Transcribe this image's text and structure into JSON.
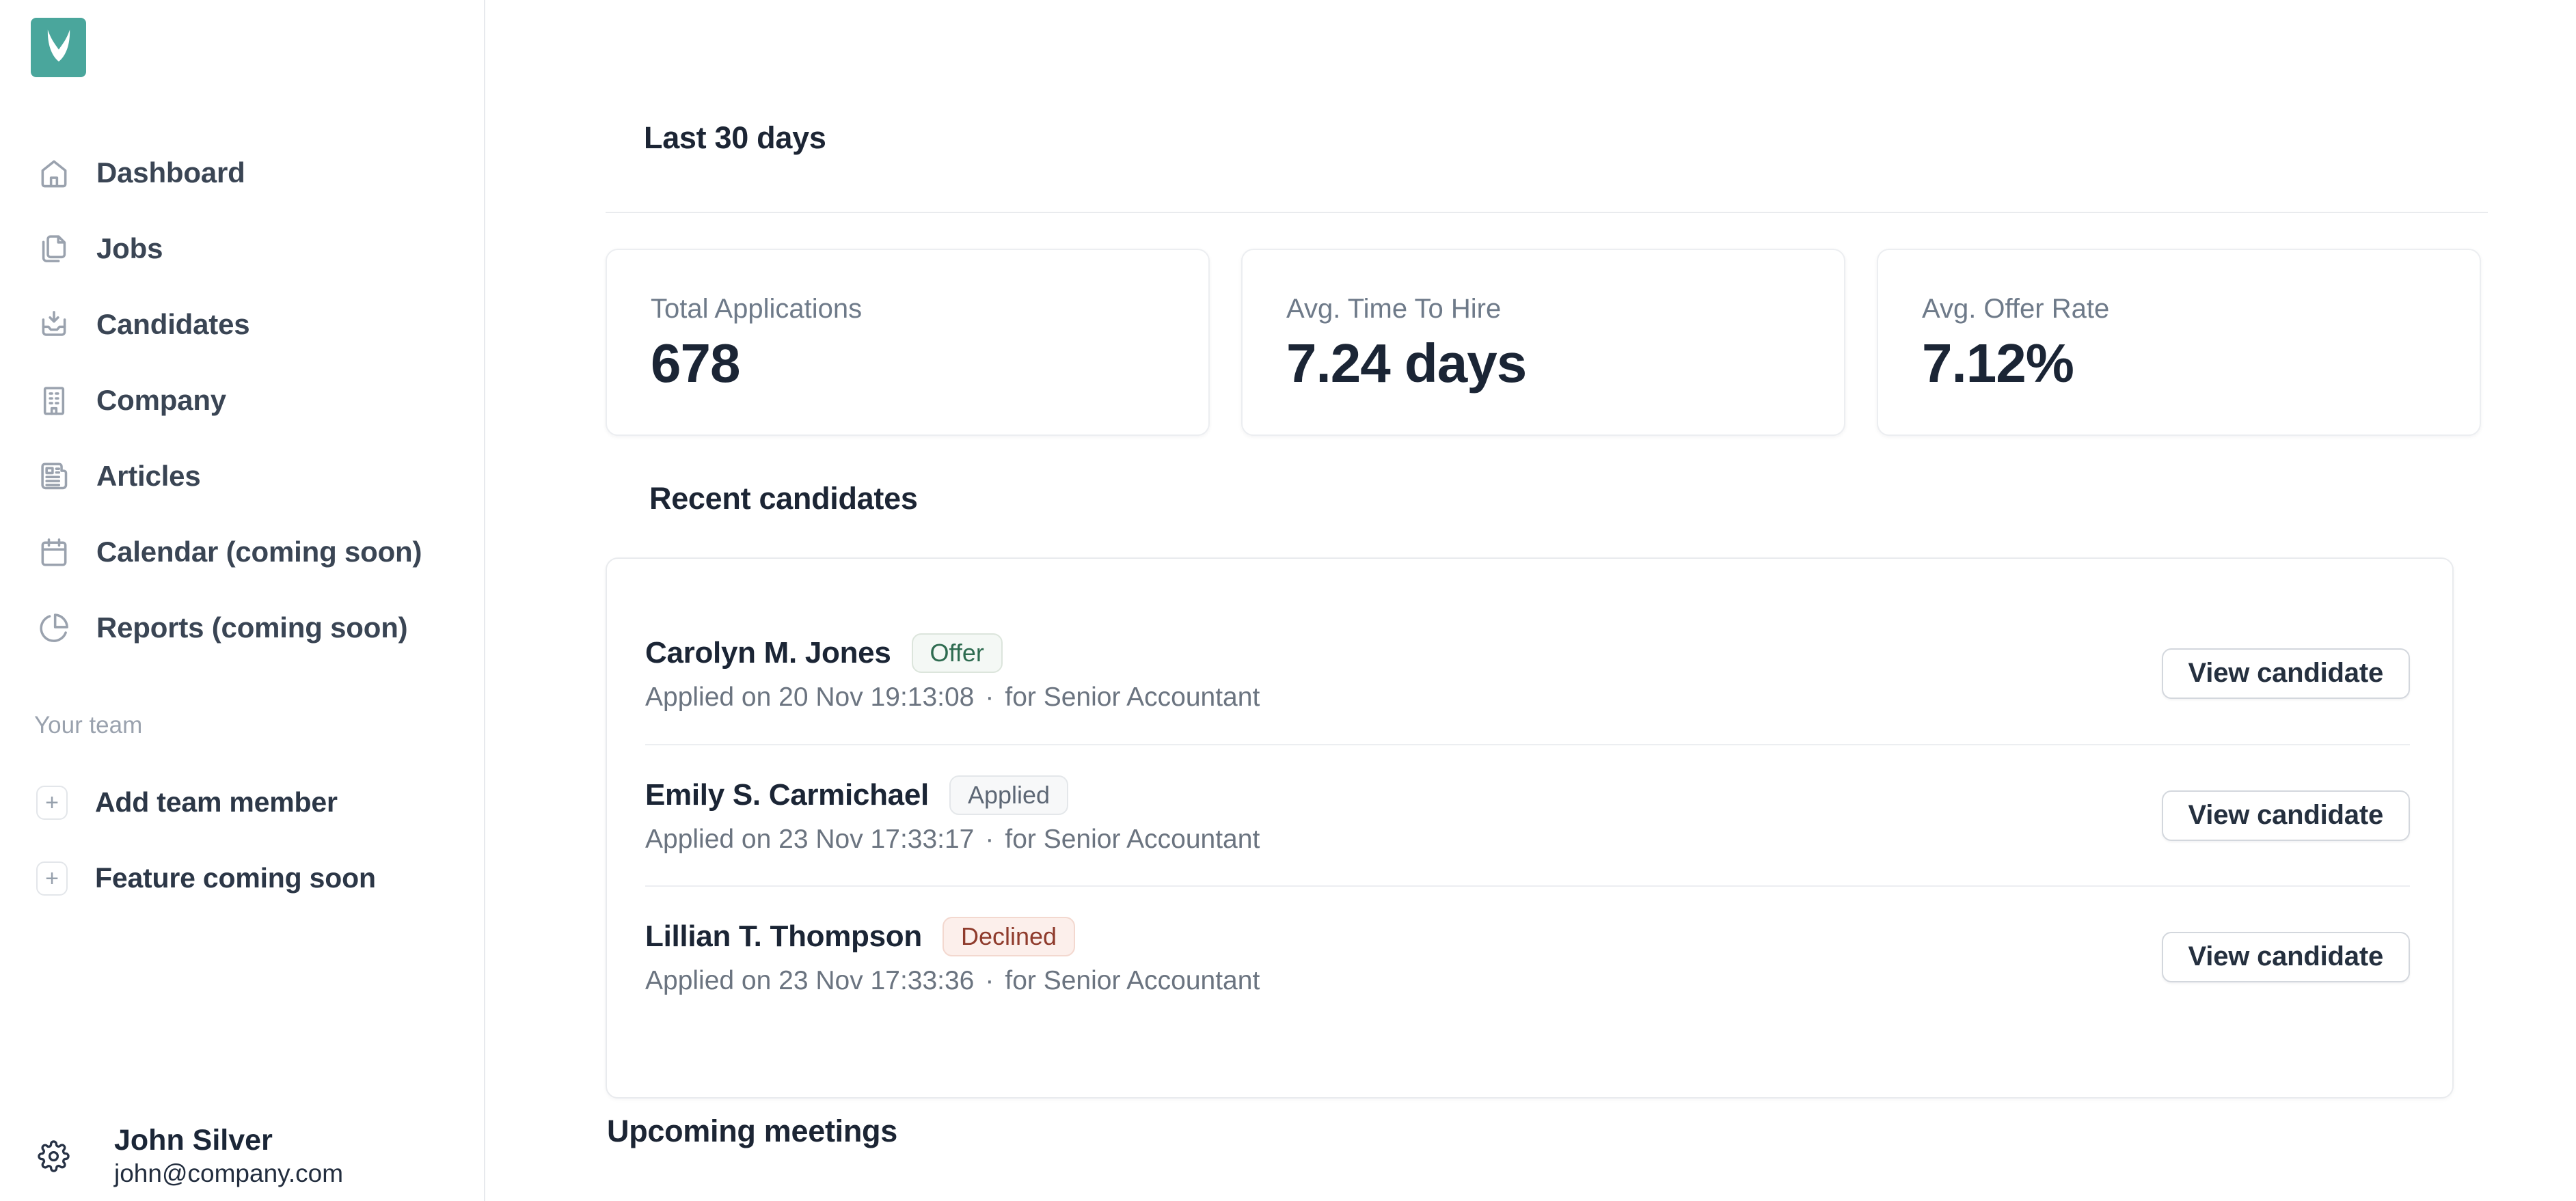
{
  "colors": {
    "brand_teal": "#4aa69c",
    "dark_text": "#1b2535",
    "muted_text": "#6b7480",
    "icon_gray": "#9aa2ae",
    "border_gray": "#e9ebee",
    "status_offer_text": "#2e6b50",
    "status_applied_text": "#5d6775",
    "status_declined_text": "#8f3b2c"
  },
  "sidebar": {
    "logo_icon": "butterfly-logo",
    "nav": [
      {
        "label": "Dashboard",
        "icon": "home-icon"
      },
      {
        "label": "Jobs",
        "icon": "document-icon"
      },
      {
        "label": "Candidates",
        "icon": "inbox-down-icon"
      },
      {
        "label": "Company",
        "icon": "building-icon"
      },
      {
        "label": "Articles",
        "icon": "newspaper-icon"
      },
      {
        "label": "Calendar (coming soon)",
        "icon": "calendar-icon"
      },
      {
        "label": "Reports (coming soon)",
        "icon": "pie-chart-icon"
      }
    ],
    "team_section_label": "Your team",
    "plus_glyph": "+",
    "team_items": [
      {
        "label": "Add team member",
        "icon": "plus-icon"
      },
      {
        "label": "Feature coming soon",
        "icon": "plus-icon"
      }
    ],
    "user": {
      "name": "John Silver",
      "email": "john@company.com",
      "settings_icon": "gear-icon"
    }
  },
  "main": {
    "period_heading": "Last 30 days",
    "stats": [
      {
        "label": "Total Applications",
        "value": "678"
      },
      {
        "label": "Avg. Time To Hire",
        "value": "7.24 days"
      },
      {
        "label": "Avg. Offer Rate",
        "value": "7.12%"
      }
    ],
    "recent": {
      "heading": "Recent candidates",
      "action_label": "View candidate",
      "rows": [
        {
          "name": "Carolyn M. Jones",
          "status": "Offer",
          "applied": "Applied on 20 Nov 19:13:08",
          "separator": "·",
          "role": "for Senior Accountant"
        },
        {
          "name": "Emily S. Carmichael",
          "status": "Applied",
          "applied": "Applied on 23 Nov 17:33:17",
          "separator": "·",
          "role": "for Senior Accountant"
        },
        {
          "name": "Lillian T. Thompson",
          "status": "Declined",
          "applied": "Applied on 23 Nov 17:33:36",
          "separator": "·",
          "role": "for Senior Accountant"
        }
      ]
    },
    "upcoming_heading": "Upcoming meetings"
  }
}
